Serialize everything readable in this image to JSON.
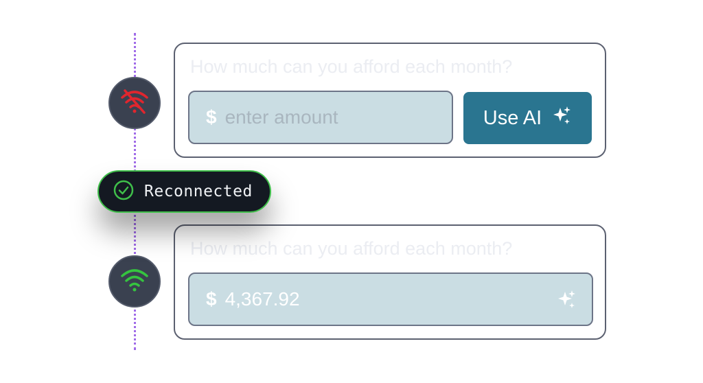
{
  "offline_card": {
    "question": "How much can you afford each month?",
    "currency_symbol": "$",
    "amount_placeholder": "enter amount",
    "ai_button_label": "Use AI"
  },
  "toast": {
    "label": "Reconnected",
    "icon": "check-circle-icon",
    "accent_color": "#3fbf4a"
  },
  "online_card": {
    "question": "How much can you afford each month?",
    "currency_symbol": "$",
    "amount_value": "4,367.92"
  },
  "status_icons": {
    "offline": "wifi-off-icon",
    "online": "wifi-icon",
    "offline_color": "#e0262e",
    "online_color": "#35c43f"
  },
  "colors": {
    "timeline": "#a06be8",
    "button": "#2a7590",
    "field": "#cadde3"
  }
}
